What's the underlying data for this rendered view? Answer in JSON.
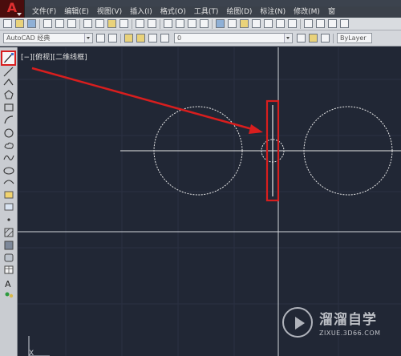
{
  "app": {
    "logo_letter": "A"
  },
  "menu": {
    "items": [
      {
        "label": "文件(F)"
      },
      {
        "label": "编辑(E)"
      },
      {
        "label": "视图(V)"
      },
      {
        "label": "插入(I)"
      },
      {
        "label": "格式(O)"
      },
      {
        "label": "工具(T)"
      },
      {
        "label": "绘图(D)"
      },
      {
        "label": "标注(N)"
      },
      {
        "label": "修改(M)"
      },
      {
        "label": "窗"
      }
    ]
  },
  "toolbar2": {
    "workspace_value": "AutoCAD 经典",
    "layer_value": "0",
    "bylayer_value": "ByLayer"
  },
  "sidebar": {
    "tools": [
      {
        "name": "line-tool-icon",
        "active": true
      },
      {
        "name": "construction-line-icon"
      },
      {
        "name": "polyline-icon"
      },
      {
        "name": "polygon-icon"
      },
      {
        "name": "rectangle-icon"
      },
      {
        "name": "arc-icon"
      },
      {
        "name": "circle-icon"
      },
      {
        "name": "revision-cloud-icon"
      },
      {
        "name": "spline-icon"
      },
      {
        "name": "ellipse-icon"
      },
      {
        "name": "ellipse-arc-icon"
      },
      {
        "name": "insert-block-icon"
      },
      {
        "name": "make-block-icon"
      },
      {
        "name": "point-icon"
      },
      {
        "name": "hatch-icon"
      },
      {
        "name": "gradient-icon"
      },
      {
        "name": "region-icon"
      },
      {
        "name": "table-icon"
      },
      {
        "name": "multiline-text-icon"
      },
      {
        "name": "add-selected-icon"
      }
    ]
  },
  "canvas": {
    "view_label": "[−][俯视][二维线框]",
    "ucs_label": "X"
  },
  "colors": {
    "canvas_bg": "#212735",
    "drawing_line": "#e8e8e8",
    "highlight_red": "#d81e1e"
  },
  "watermark": {
    "title": "溜溜自学",
    "url": "ZIXUE.3D66.COM"
  }
}
